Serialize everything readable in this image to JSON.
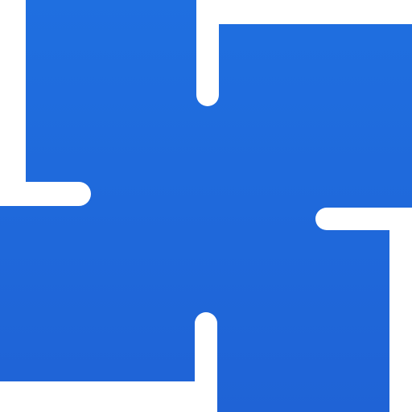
{
  "logo": {
    "icon_name": "four-square-blue-logo",
    "background_color": "#ffffff",
    "colors": {
      "top": "#1f6fe0",
      "bottom": "#1f63d6"
    }
  }
}
